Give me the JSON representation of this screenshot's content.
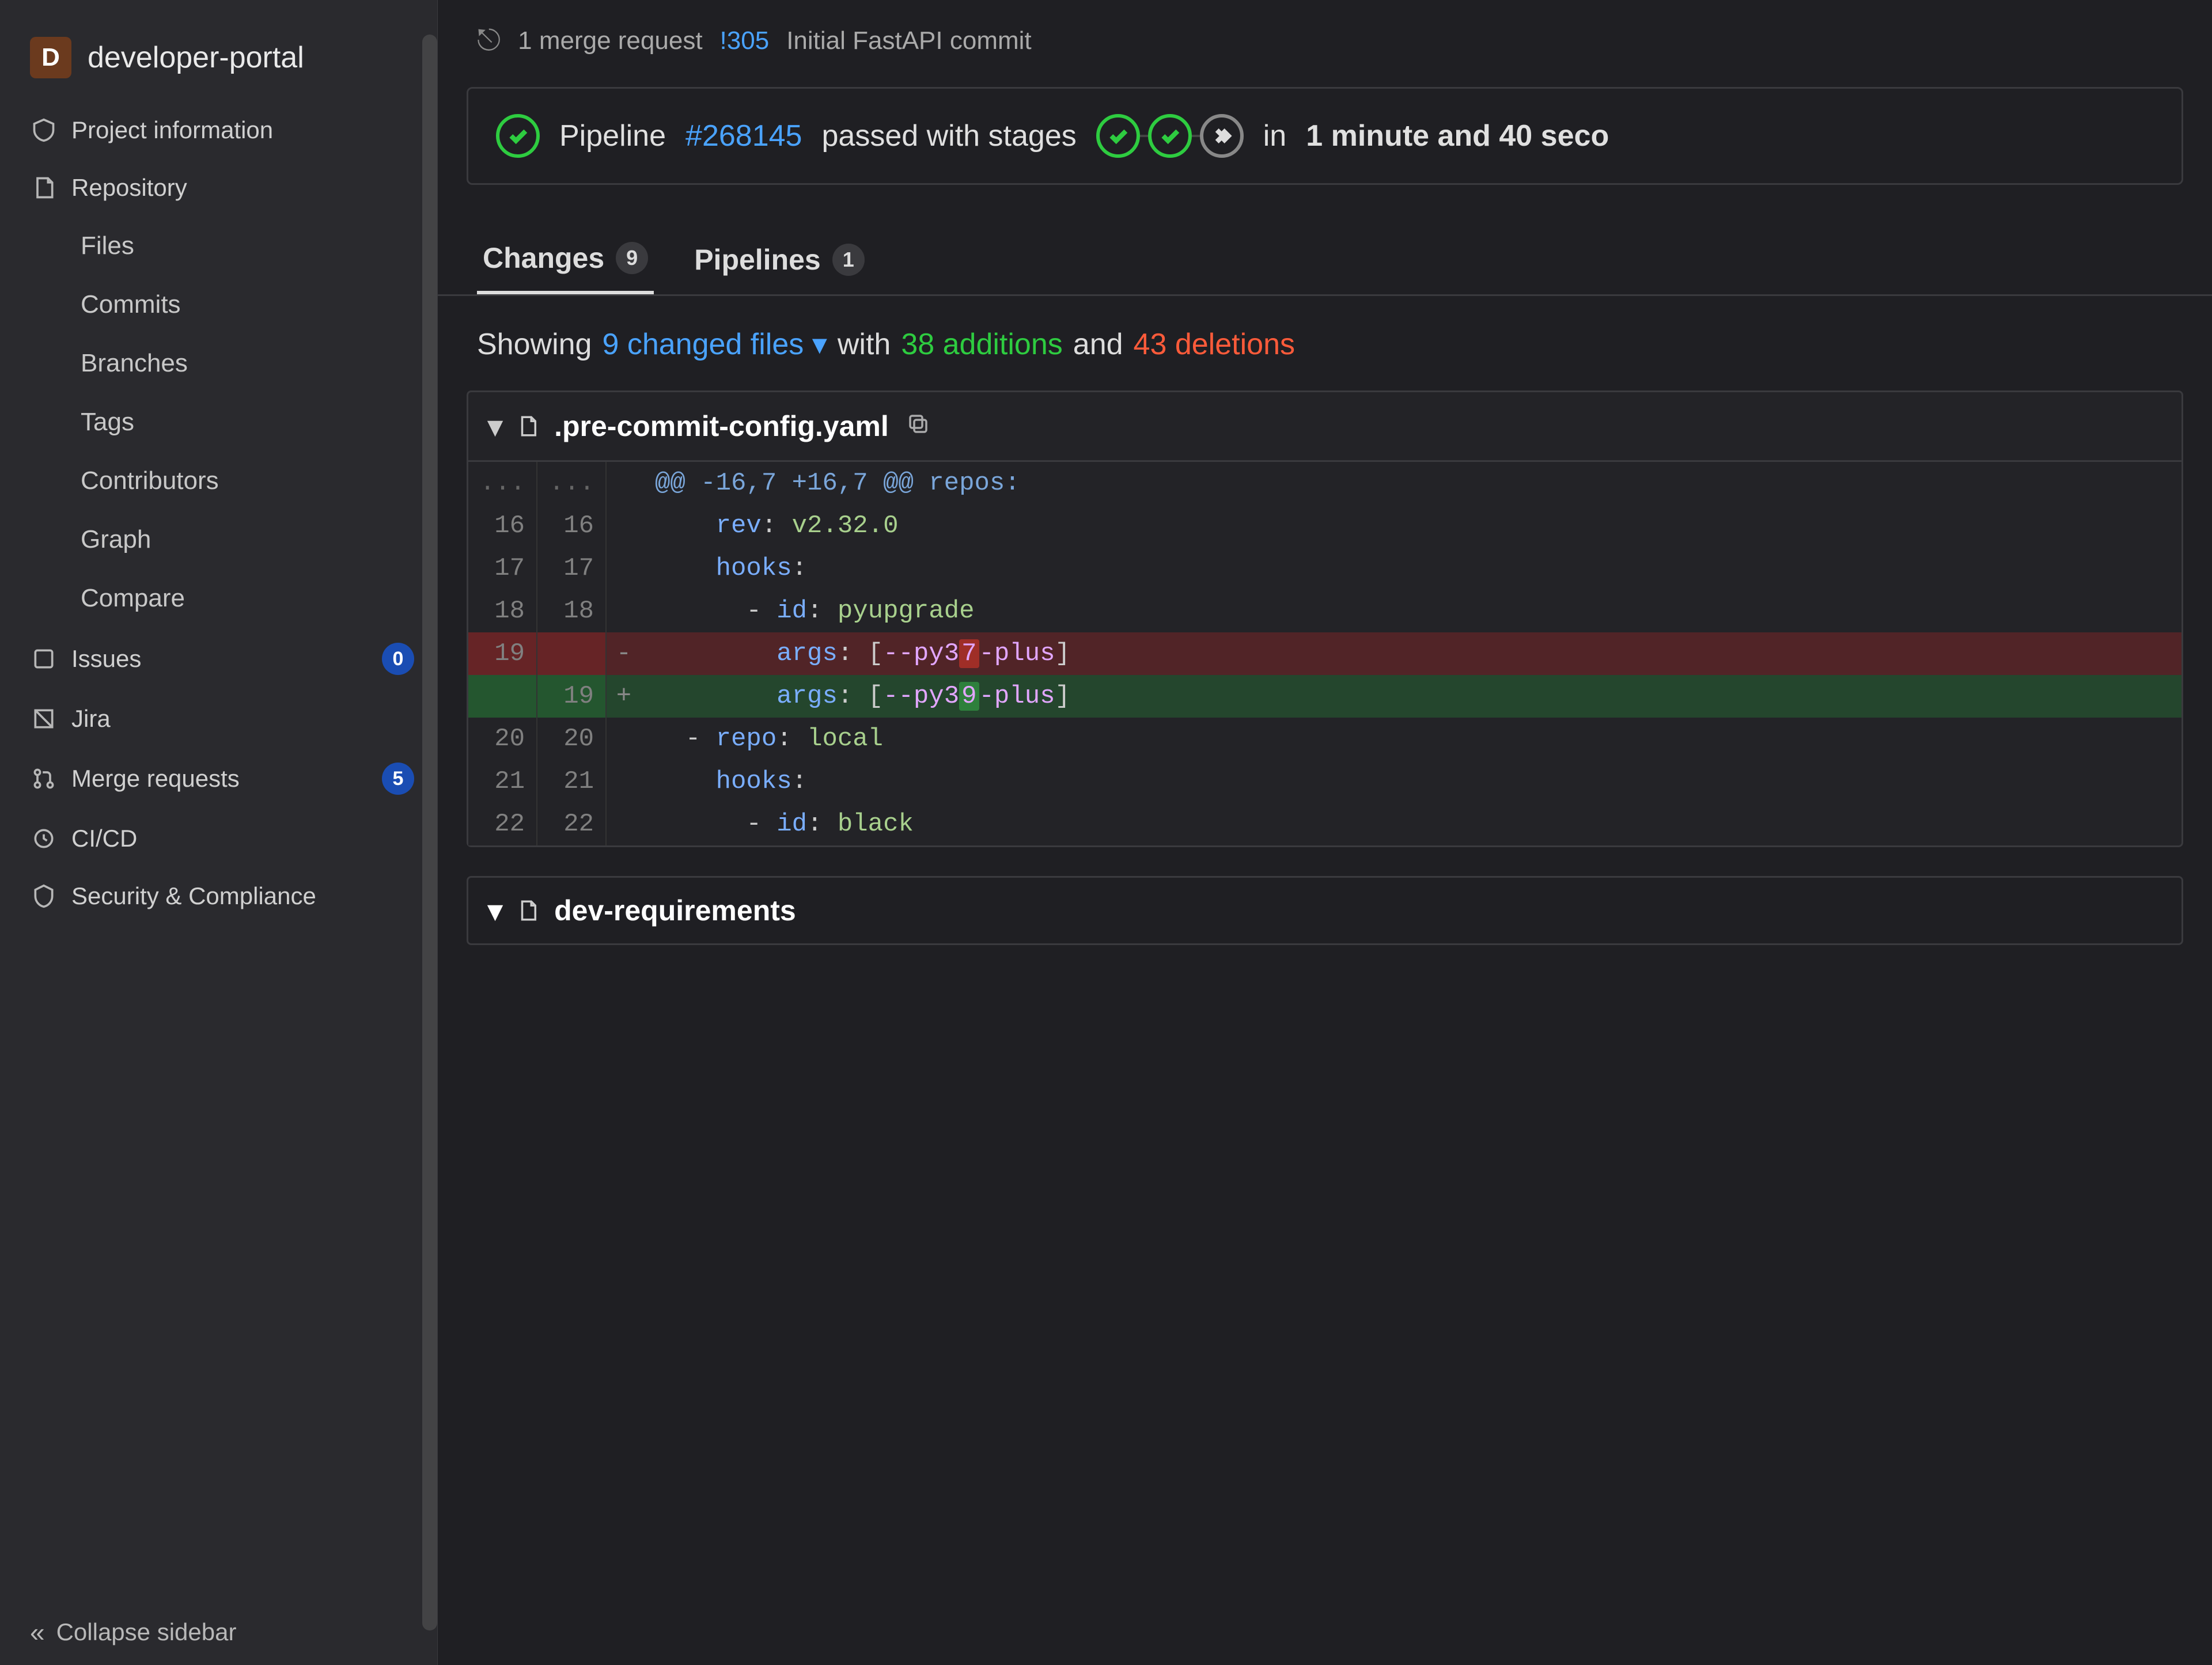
{
  "project": {
    "initial": "D",
    "name": "developer-portal"
  },
  "sidebar": {
    "project_info": "Project information",
    "repository": "Repository",
    "repo_items": [
      "Files",
      "Commits",
      "Branches",
      "Tags",
      "Contributors",
      "Graph",
      "Compare"
    ],
    "issues": {
      "label": "Issues",
      "count": "0"
    },
    "jira": "Jira",
    "merge_requests": {
      "label": "Merge requests",
      "count": "5"
    },
    "cicd": "CI/CD",
    "security": "Security & Compliance",
    "collapse": "Collapse sidebar"
  },
  "mr_strip": {
    "text": "1 merge request",
    "link": "!305",
    "title": "Initial FastAPI commit"
  },
  "pipeline": {
    "prefix": "Pipeline",
    "id": "#268145",
    "status_text": "passed with stages",
    "duration_prefix": "in",
    "duration": "1 minute and 40 seco"
  },
  "tabs": {
    "changes": {
      "label": "Changes",
      "count": "9"
    },
    "pipelines": {
      "label": "Pipelines",
      "count": "1"
    }
  },
  "summary": {
    "showing": "Showing",
    "changed": "9 changed files",
    "with": "with",
    "additions": "38 additions",
    "and": "and",
    "deletions": "43 deletions"
  },
  "file": {
    "name": ".pre-commit-config.yaml",
    "hunk": "@@ -16,7 +16,7 @@ repos:",
    "lines": [
      {
        "old": "16",
        "new": "16",
        "sign": " ",
        "html": "    <span class='k-key'>rev</span><span class='k-punc'>:</span> <span class='k-str'>v2.32.0</span>"
      },
      {
        "old": "17",
        "new": "17",
        "sign": " ",
        "html": "    <span class='k-key'>hooks</span><span class='k-punc'>:</span>"
      },
      {
        "old": "18",
        "new": "18",
        "sign": " ",
        "html": "      <span class='k-punc'>-</span> <span class='k-key'>id</span><span class='k-punc'>:</span> <span class='k-str'>pyupgrade</span>"
      },
      {
        "old": "19",
        "new": "",
        "sign": "-",
        "cls": "row-removed",
        "html": "        <span class='k-key'>args</span><span class='k-punc'>:</span> <span class='k-punc'>[</span><span class='k-arg'>--py3<span class='hl-del'>7</span>-plus</span><span class='k-punc'>]</span>"
      },
      {
        "old": "",
        "new": "19",
        "sign": "+",
        "cls": "row-added",
        "html": "        <span class='k-key'>args</span><span class='k-punc'>:</span> <span class='k-punc'>[</span><span class='k-arg'>--py3<span class='hl-add'>9</span>-plus</span><span class='k-punc'>]</span>"
      },
      {
        "old": "20",
        "new": "20",
        "sign": " ",
        "html": "  <span class='k-punc'>-</span> <span class='k-key'>repo</span><span class='k-punc'>:</span> <span class='k-str'>local</span>"
      },
      {
        "old": "21",
        "new": "21",
        "sign": " ",
        "html": "    <span class='k-key'>hooks</span><span class='k-punc'>:</span>"
      },
      {
        "old": "22",
        "new": "22",
        "sign": " ",
        "html": "      <span class='k-punc'>-</span> <span class='k-key'>id</span><span class='k-punc'>:</span> <span class='k-str'>black</span>"
      }
    ]
  },
  "next_file": "dev-requirements"
}
